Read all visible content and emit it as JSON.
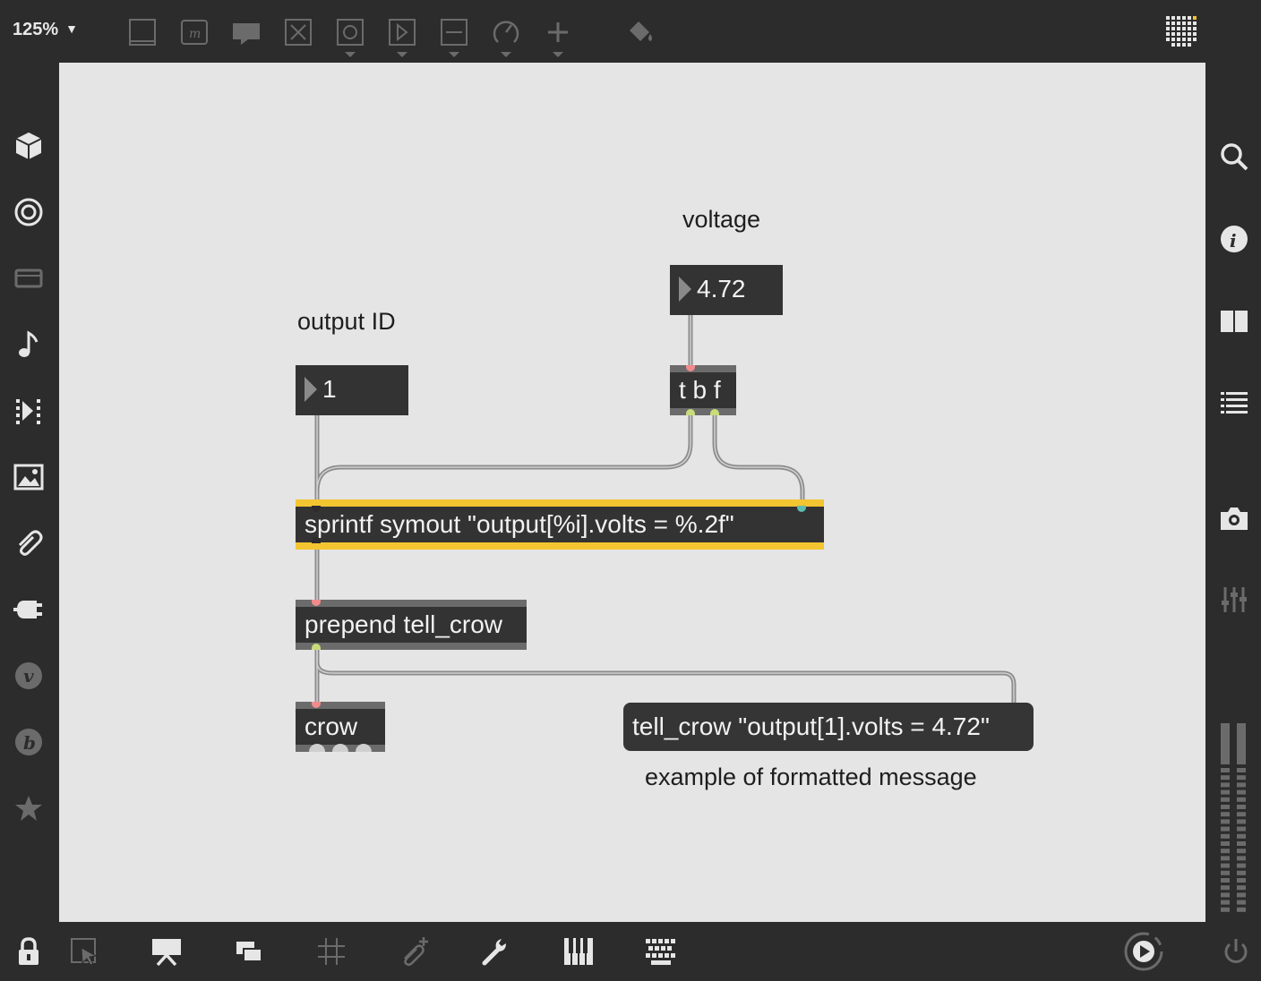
{
  "toolbar": {
    "zoom": "125%",
    "icons": [
      "comment-box-icon",
      "message-m-icon",
      "speech-bubble-icon",
      "toggle-x-icon",
      "button-circle-icon",
      "play-box-icon",
      "slider-icon",
      "dial-icon",
      "plus-icon",
      "paint-bucket-icon",
      "grid-dots-icon"
    ]
  },
  "left_sidebar": [
    "package-cube-icon",
    "target-icon",
    "display-icon",
    "music-note-icon",
    "sequencer-icon",
    "image-icon",
    "paperclip-icon",
    "plug-icon",
    "v-icon",
    "b-icon",
    "star-icon"
  ],
  "right_sidebar": [
    "search-icon",
    "info-icon",
    "columns-icon",
    "list-icon",
    "camera-icon",
    "mixer-sliders-icon",
    "level-meter-icon"
  ],
  "bottom_bar": [
    "lock-icon",
    "select-arrow-icon",
    "presentation-icon",
    "windows-icon",
    "grid-icon",
    "attach-plus-icon",
    "wrench-icon",
    "piano-icon",
    "keyboard-icon",
    "transport-play-icon",
    "power-icon"
  ],
  "patch": {
    "label_voltage": "voltage",
    "label_output_id": "output ID",
    "voltage_value": "4.72",
    "output_id_value": "1",
    "trigger": "t b f",
    "sprintf": "sprintf symout \"output[%i].volts = %.2f\"",
    "prepend": "prepend tell_crow",
    "crow": "crow",
    "message": "tell_crow \"output[1].volts = 4.72\"",
    "message_caption": "example of formatted message"
  },
  "colors": {
    "canvas": "#e5e5e5",
    "chrome": "#2c2c2c",
    "object": "#333333",
    "selected_highlight": "#f3c531",
    "patch_cord": "#8c8c8c",
    "inlet": "#f28b8b",
    "outlet_float": "#c8dc7a",
    "outlet_signal": "#5fbbb0"
  }
}
